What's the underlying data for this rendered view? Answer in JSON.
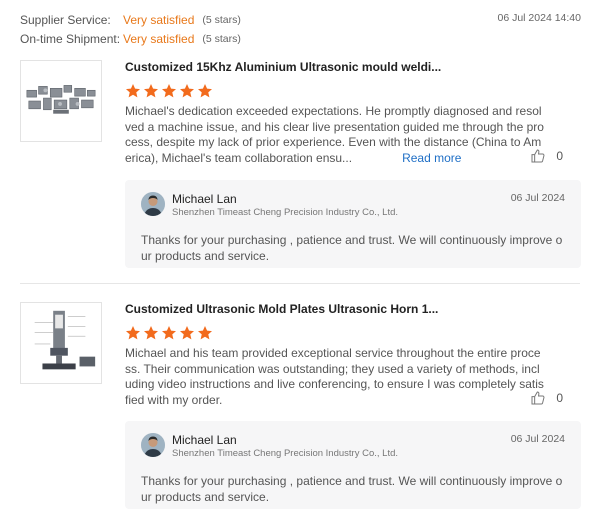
{
  "summary": {
    "supplier_service_label": "Supplier Service:",
    "supplier_service_value": "Very satisfied",
    "supplier_service_stars": "(5 stars)",
    "ontime_label": "On-time Shipment:",
    "ontime_value": "Very satisfied",
    "ontime_stars": "(5 stars)",
    "date": "06 Jul 2024 14:40"
  },
  "colors": {
    "star": "#f26b1d",
    "accent": "#e8781a",
    "link": "#1f6fc6"
  },
  "reviews": [
    {
      "title": "Customized 15Khz Aluminium Ultrasonic mould weldi...",
      "rating": 5,
      "text": "Michael's dedication exceeded expectations. He promptly diagnosed and resolved a machine issue, and his clear live presentation guided me through the process, despite my lack of prior experience. Even with the distance (China to America), Michael's team collaboration ensu...",
      "read_more": "Read more",
      "likes": "0",
      "reply": {
        "name": "Michael Lan",
        "company": "Shenzhen Timeast Cheng Precision Industry Co., Ltd.",
        "date": "06 Jul 2024",
        "text": "Thanks for your purchasing , patience and trust. We will continuously improve our products and service."
      }
    },
    {
      "title": "Customized Ultrasonic Mold Plates Ultrasonic Horn 1...",
      "rating": 5,
      "text": "Michael and his team provided exceptional service throughout the entire process. Their communication was outstanding; they used a variety of methods, including video instructions and live conferencing, to ensure I was completely satisfied with my order.",
      "likes": "0",
      "reply": {
        "name": "Michael Lan",
        "company": "Shenzhen Timeast Cheng Precision Industry Co., Ltd.",
        "date": "06 Jul 2024",
        "text": "Thanks for your purchasing , patience and trust. We will continuously improve our products and service."
      }
    }
  ]
}
